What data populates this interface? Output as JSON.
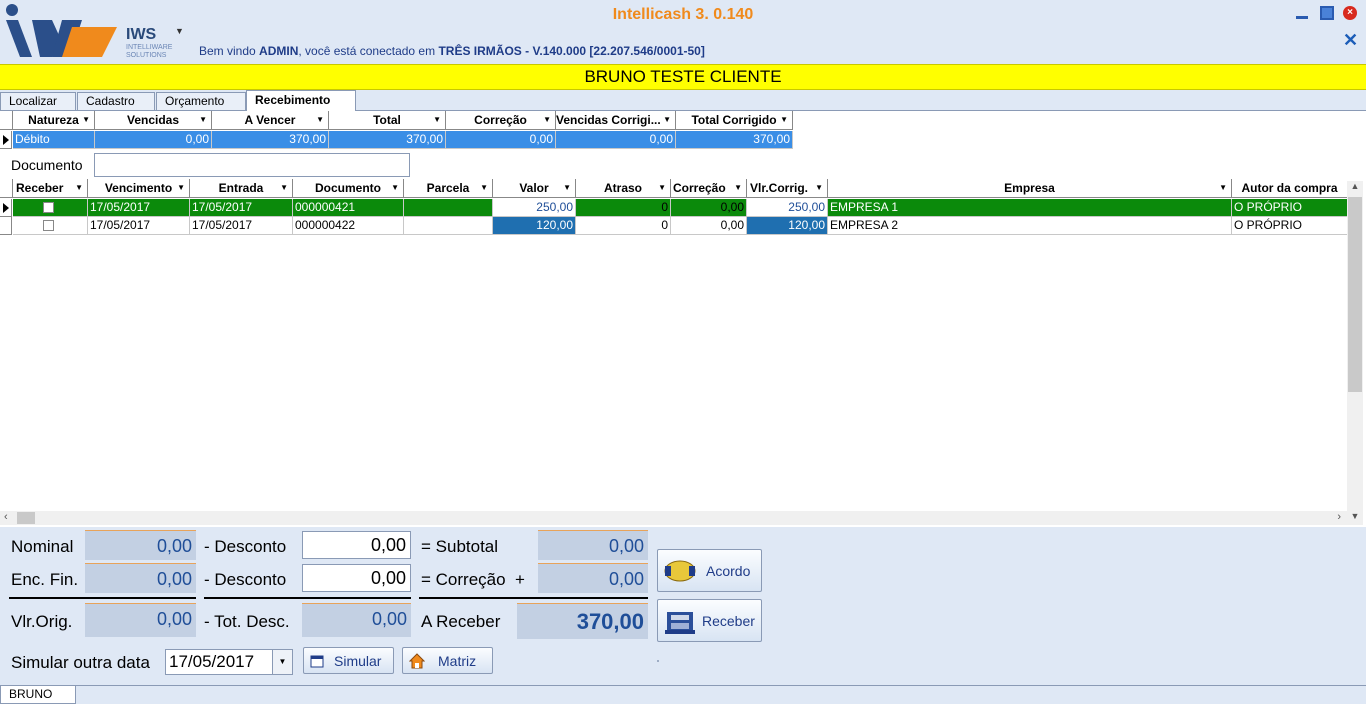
{
  "header": {
    "app_title": "Intellicash 3. 0.140",
    "logo_text": "IWS",
    "logo_sub": "INTELLIWARE SOLUTIONS",
    "welcome_prefix": "Bem vindo ",
    "welcome_user": "ADMIN",
    "welcome_mid": ", você está conectado em ",
    "welcome_company": "TRÊS IRMÃOS - V.140.000 [22.207.546/0001-50]"
  },
  "client_name": "BRUNO TESTE CLIENTE",
  "tabs": [
    {
      "label": "Localizar"
    },
    {
      "label": "Cadastro"
    },
    {
      "label": "Orçamento"
    },
    {
      "label": "Recebimento"
    }
  ],
  "summary_grid": {
    "headers": [
      "Natureza",
      "Vencidas",
      "A Vencer",
      "Total",
      "Correção",
      "Vencidas Corrigi...",
      "Total Corrigido"
    ],
    "row": [
      "Débito",
      "0,00",
      "370,00",
      "370,00",
      "0,00",
      "0,00",
      "370,00"
    ]
  },
  "documento": {
    "label": "Documento",
    "value": ""
  },
  "main_grid": {
    "headers": [
      "Receber",
      "Vencimento",
      "Entrada",
      "Documento",
      "Parcela",
      "Valor",
      "Atraso",
      "Correção",
      "Vlr.Corrig.",
      "Empresa",
      "Autor da compra"
    ],
    "rows": [
      {
        "vencimento": "17/05/2017",
        "entrada": "17/05/2017",
        "documento": "000000421",
        "parcela": "",
        "valor": "250,00",
        "atraso": "0",
        "correcao": "0,00",
        "vlr_corrig": "250,00",
        "empresa": "EMPRESA 1",
        "autor": "O PRÓPRIO"
      },
      {
        "vencimento": "17/05/2017",
        "entrada": "17/05/2017",
        "documento": "000000422",
        "parcela": "",
        "valor": "120,00",
        "atraso": "0",
        "correcao": "0,00",
        "vlr_corrig": "120,00",
        "empresa": "EMPRESA 2",
        "autor": "O PRÓPRIO"
      }
    ]
  },
  "totals": {
    "nominal_label": "Nominal",
    "nominal": "0,00",
    "desconto1_label": "- Desconto",
    "desconto1": "0,00",
    "subtotal_label": "= Subtotal",
    "subtotal": "0,00",
    "encfin_label": "Enc. Fin.",
    "encfin": "0,00",
    "desconto2_label": "- Desconto",
    "desconto2": "0,00",
    "correcao_label": "= Correção  +",
    "correcao": "0,00",
    "vlrorig_label": "Vlr.Orig.",
    "vlrorig": "0,00",
    "totdesc_label": "- Tot. Desc.",
    "totdesc": "0,00",
    "areceber_label": "A Receber",
    "areceber": "370,00",
    "simular_label": "Simular outra data",
    "simular_date": "17/05/2017"
  },
  "buttons": {
    "acordo": "Acordo",
    "receber": "Receber",
    "simular": "Simular",
    "matriz": "Matriz"
  },
  "status_tab": "BRUNO"
}
